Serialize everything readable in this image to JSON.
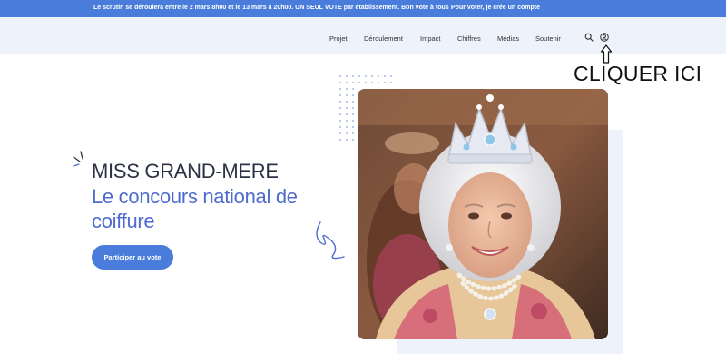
{
  "topbar": {
    "message": "Le scrutin se déroulera entre le 2 mars 8h00 et le 13 mars à 20h00. UN SEUL VOTE par établissement. Bon vote à tous !",
    "cta": "Pour voter, je crée un compte"
  },
  "nav": {
    "items": [
      "Projet",
      "Déroulement",
      "Impact",
      "Chiffres",
      "Médias",
      "Soutenir"
    ],
    "icons": [
      "search-icon",
      "user-account-icon"
    ]
  },
  "annotation": {
    "text": "CLIQUER ICI"
  },
  "hero": {
    "title": "MISS GRAND-MERE",
    "subtitle": "Le concours national de coiffure",
    "button_label": "Participer au vote"
  },
  "colors": {
    "brand_blue": "#4a7ddb",
    "accent_blue": "#4f6bd0",
    "nav_bg": "#eef2fb",
    "title_dark": "#2b3245"
  }
}
